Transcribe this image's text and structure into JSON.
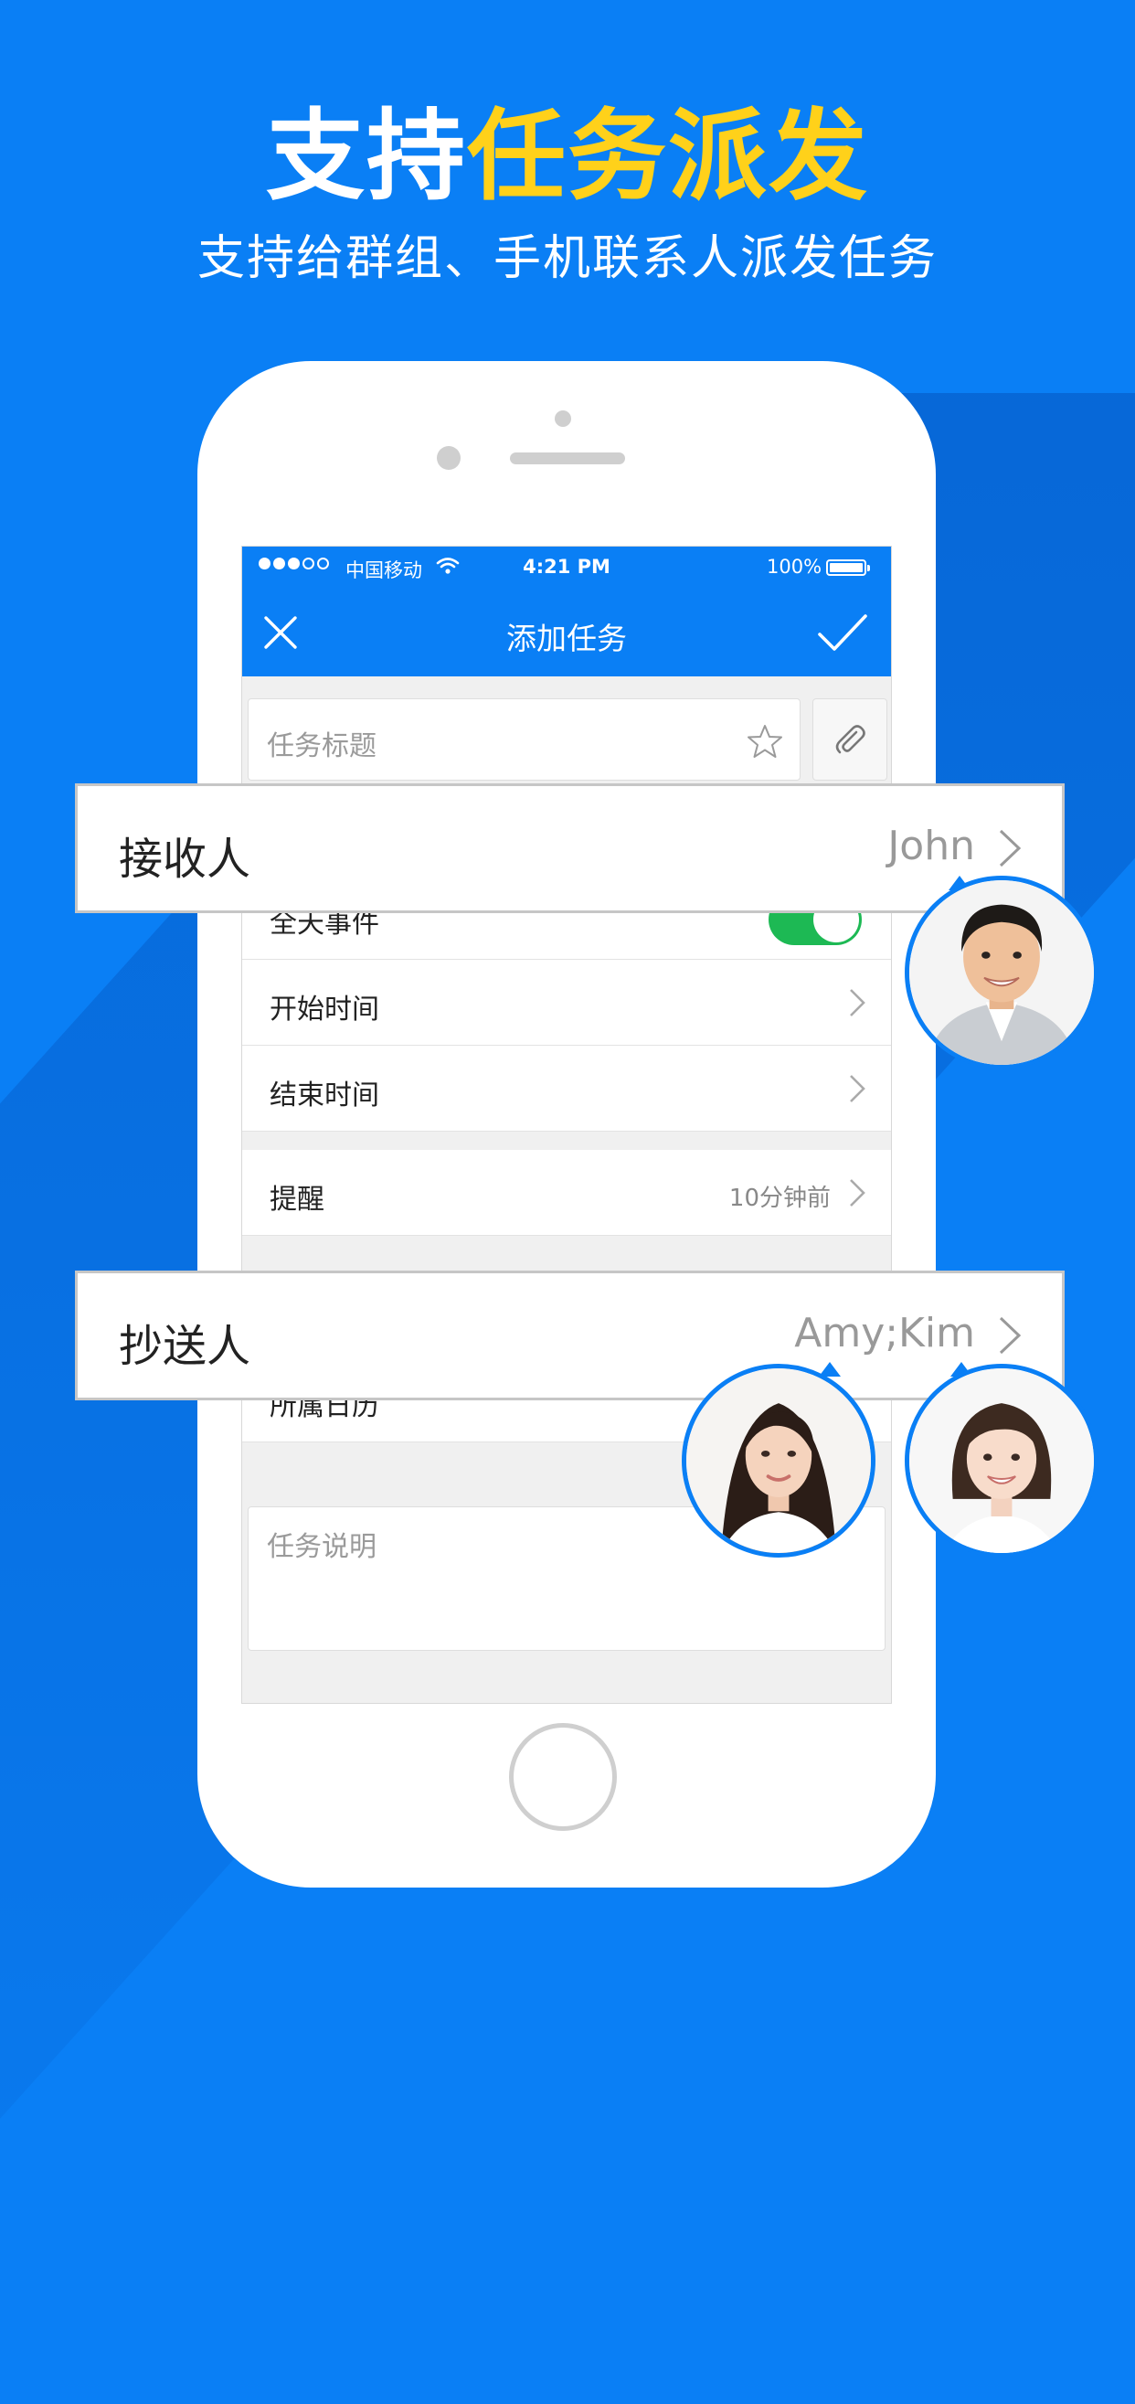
{
  "headline": {
    "part1": "支持",
    "part2": "任务派发"
  },
  "subline": "支持给群组、手机联系人派发任务",
  "status_bar": {
    "carrier": "中国移动",
    "time": "4:21 PM",
    "battery": "100%"
  },
  "nav": {
    "title": "添加任务"
  },
  "form": {
    "title_placeholder": "任务标题",
    "all_day_label": "全天事件",
    "all_day_on": true,
    "start_label": "开始时间",
    "end_label": "结束时间",
    "reminder_label": "提醒",
    "reminder_value": "10分钟前",
    "calendar_label": "所属日历",
    "description_placeholder": "任务说明"
  },
  "callouts": {
    "recipient": {
      "label": "接收人",
      "value": "John"
    },
    "cc": {
      "label": "抄送人",
      "value": "Amy;Kim"
    }
  },
  "icons": [
    "close-icon",
    "check-icon",
    "star-icon",
    "paperclip-icon",
    "wifi-icon",
    "chevron-right-icon"
  ],
  "colors": {
    "brand_blue": "#0a7ff5",
    "highlight_yellow": "#ffd11a",
    "toggle_green": "#1db954"
  }
}
